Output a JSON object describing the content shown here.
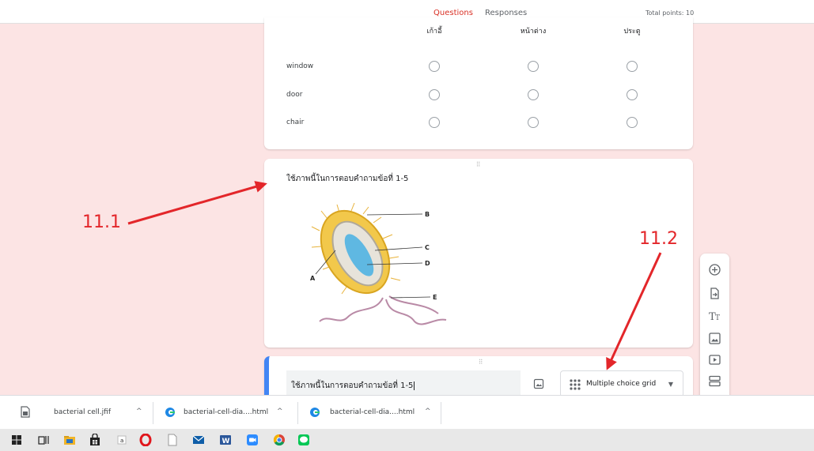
{
  "header": {
    "tabs": [
      {
        "label": "Questions",
        "active": true
      },
      {
        "label": "Responses",
        "active": false
      }
    ],
    "total_points": "Total points: 10"
  },
  "grid_question": {
    "columns": [
      "เก้าอี้",
      "หน้าต่าง",
      "ประตู"
    ],
    "rows": [
      "window",
      "door",
      "chair"
    ]
  },
  "image_item": {
    "caption": "ใช้ภาพนี้ในการตอบคำถามข้อที่ 1-5",
    "figure_labels": [
      "A",
      "B",
      "C",
      "D",
      "E"
    ]
  },
  "editing_question": {
    "title_value": "ใช้ภาพนี้ในการตอบคำถามข้อที่ 1-5",
    "question_type": "Multiple choice grid"
  },
  "toolbar": {
    "icons": [
      "add-question-icon",
      "import-questions-icon",
      "add-title-icon",
      "add-image-icon",
      "add-video-icon",
      "add-section-icon"
    ]
  },
  "annotations": [
    {
      "label": "11.1"
    },
    {
      "label": "11.2"
    }
  ],
  "downloads": [
    {
      "name": "bacterial cell.jfif",
      "icon": "image-file-icon"
    },
    {
      "name": "bacterial-cell-dia....html",
      "icon": "edge-file-icon"
    },
    {
      "name": "bacterial-cell-dia....html",
      "icon": "edge-file-icon"
    }
  ],
  "taskbar": {
    "icons": [
      "windows-start-icon",
      "task-view-icon",
      "file-explorer-icon",
      "store-icon",
      "app-icon",
      "opera-icon",
      "notepad-icon",
      "mail-icon",
      "word-icon",
      "zoom-icon",
      "chrome-icon",
      "line-icon"
    ]
  },
  "colors": {
    "accent_red": "#d93025",
    "focus_blue": "#4285f4",
    "annotation_red": "#e3262a",
    "background_pink": "#fce4e4"
  }
}
